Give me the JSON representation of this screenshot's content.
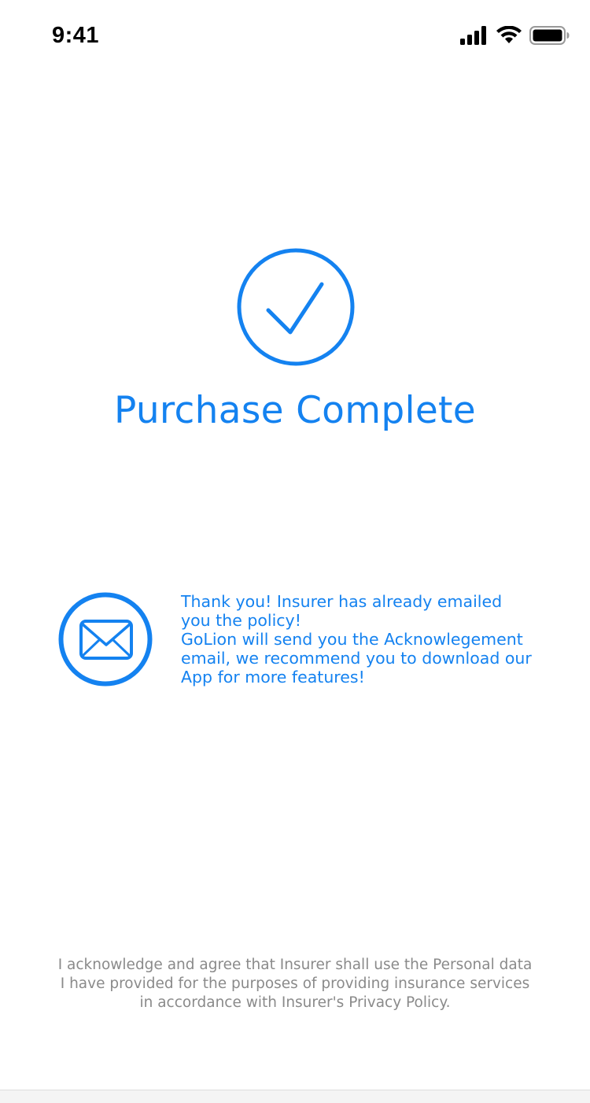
{
  "status_bar": {
    "time": "9:41",
    "icons": [
      "cellular-signal-icon",
      "wifi-icon",
      "battery-icon"
    ]
  },
  "success": {
    "icon": "checkmark-circle-icon",
    "title": "Purchase Complete"
  },
  "notice": {
    "icon": "mail-circle-icon",
    "lines": [
      "Thank you!  Insurer has already emailed",
      "you the policy!",
      "GoLion will send you the Acknowlegement",
      "email, we recommend you to download our",
      "App for more features!"
    ]
  },
  "disclaimer": {
    "lines": [
      "I acknowledge and agree that Insurer shall use the Personal data",
      "I have provided for the purposes of providing insurance services",
      "in accordance with Insurer's Privacy Policy."
    ]
  },
  "colors": {
    "accent": "#1482F0",
    "disclaimer_text": "#8A8A8A",
    "background": "#FFFFFF"
  }
}
